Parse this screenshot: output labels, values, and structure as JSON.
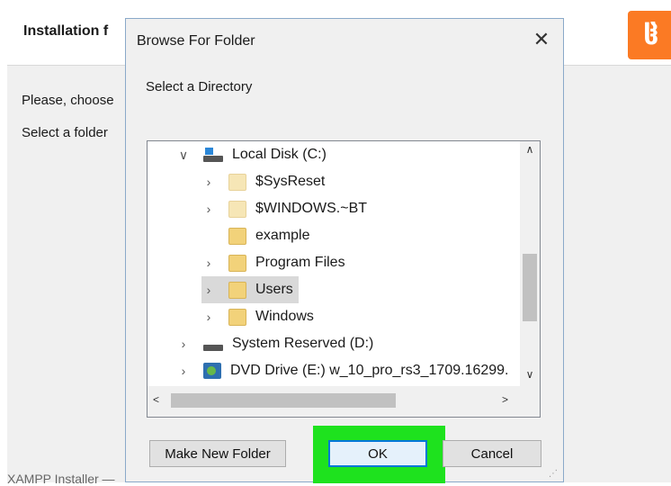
{
  "background_window": {
    "title": "Installation f",
    "text_line1": "Please, choose",
    "text_line2": "Select a folder",
    "footer": "XAMPP Installer —",
    "logo_glyph": "ჱ"
  },
  "dialog": {
    "title": "Browse For Folder",
    "close_glyph": "✕",
    "prompt": "Select a Directory",
    "tree": [
      {
        "label": "Local Disk (C:)",
        "icon": "drive-icon",
        "expanded": true
      },
      {
        "label": "$SysReset",
        "icon": "folder-icon"
      },
      {
        "label": "$WINDOWS.~BT",
        "icon": "folder-icon"
      },
      {
        "label": "example",
        "icon": "folder-icon"
      },
      {
        "label": "Program Files",
        "icon": "folder-icon"
      },
      {
        "label": "Users",
        "icon": "folder-icon",
        "selected": true
      },
      {
        "label": "Windows",
        "icon": "folder-icon"
      },
      {
        "label": "System Reserved (D:)",
        "icon": "drive-icon"
      },
      {
        "label": "DVD Drive (E:) w_10_pro_rs3_1709.16299.",
        "icon": "dvd-icon"
      }
    ],
    "buttons": {
      "new_folder": "Make New Folder",
      "ok": "OK",
      "cancel": "Cancel"
    },
    "highlight_color": "#1ee21e"
  }
}
